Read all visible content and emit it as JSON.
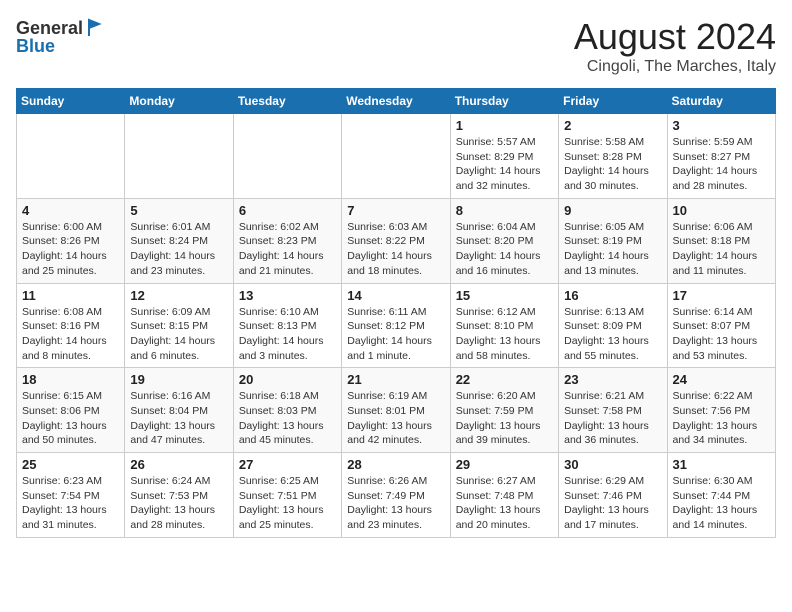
{
  "header": {
    "logo": {
      "line1": "General",
      "line2": "Blue"
    },
    "title": "August 2024",
    "location": "Cingoli, The Marches, Italy"
  },
  "calendar": {
    "weekdays": [
      "Sunday",
      "Monday",
      "Tuesday",
      "Wednesday",
      "Thursday",
      "Friday",
      "Saturday"
    ],
    "weeks": [
      [
        {
          "day": "",
          "info": ""
        },
        {
          "day": "",
          "info": ""
        },
        {
          "day": "",
          "info": ""
        },
        {
          "day": "",
          "info": ""
        },
        {
          "day": "1",
          "info": "Sunrise: 5:57 AM\nSunset: 8:29 PM\nDaylight: 14 hours\nand 32 minutes."
        },
        {
          "day": "2",
          "info": "Sunrise: 5:58 AM\nSunset: 8:28 PM\nDaylight: 14 hours\nand 30 minutes."
        },
        {
          "day": "3",
          "info": "Sunrise: 5:59 AM\nSunset: 8:27 PM\nDaylight: 14 hours\nand 28 minutes."
        }
      ],
      [
        {
          "day": "4",
          "info": "Sunrise: 6:00 AM\nSunset: 8:26 PM\nDaylight: 14 hours\nand 25 minutes."
        },
        {
          "day": "5",
          "info": "Sunrise: 6:01 AM\nSunset: 8:24 PM\nDaylight: 14 hours\nand 23 minutes."
        },
        {
          "day": "6",
          "info": "Sunrise: 6:02 AM\nSunset: 8:23 PM\nDaylight: 14 hours\nand 21 minutes."
        },
        {
          "day": "7",
          "info": "Sunrise: 6:03 AM\nSunset: 8:22 PM\nDaylight: 14 hours\nand 18 minutes."
        },
        {
          "day": "8",
          "info": "Sunrise: 6:04 AM\nSunset: 8:20 PM\nDaylight: 14 hours\nand 16 minutes."
        },
        {
          "day": "9",
          "info": "Sunrise: 6:05 AM\nSunset: 8:19 PM\nDaylight: 14 hours\nand 13 minutes."
        },
        {
          "day": "10",
          "info": "Sunrise: 6:06 AM\nSunset: 8:18 PM\nDaylight: 14 hours\nand 11 minutes."
        }
      ],
      [
        {
          "day": "11",
          "info": "Sunrise: 6:08 AM\nSunset: 8:16 PM\nDaylight: 14 hours\nand 8 minutes."
        },
        {
          "day": "12",
          "info": "Sunrise: 6:09 AM\nSunset: 8:15 PM\nDaylight: 14 hours\nand 6 minutes."
        },
        {
          "day": "13",
          "info": "Sunrise: 6:10 AM\nSunset: 8:13 PM\nDaylight: 14 hours\nand 3 minutes."
        },
        {
          "day": "14",
          "info": "Sunrise: 6:11 AM\nSunset: 8:12 PM\nDaylight: 14 hours\nand 1 minute."
        },
        {
          "day": "15",
          "info": "Sunrise: 6:12 AM\nSunset: 8:10 PM\nDaylight: 13 hours\nand 58 minutes."
        },
        {
          "day": "16",
          "info": "Sunrise: 6:13 AM\nSunset: 8:09 PM\nDaylight: 13 hours\nand 55 minutes."
        },
        {
          "day": "17",
          "info": "Sunrise: 6:14 AM\nSunset: 8:07 PM\nDaylight: 13 hours\nand 53 minutes."
        }
      ],
      [
        {
          "day": "18",
          "info": "Sunrise: 6:15 AM\nSunset: 8:06 PM\nDaylight: 13 hours\nand 50 minutes."
        },
        {
          "day": "19",
          "info": "Sunrise: 6:16 AM\nSunset: 8:04 PM\nDaylight: 13 hours\nand 47 minutes."
        },
        {
          "day": "20",
          "info": "Sunrise: 6:18 AM\nSunset: 8:03 PM\nDaylight: 13 hours\nand 45 minutes."
        },
        {
          "day": "21",
          "info": "Sunrise: 6:19 AM\nSunset: 8:01 PM\nDaylight: 13 hours\nand 42 minutes."
        },
        {
          "day": "22",
          "info": "Sunrise: 6:20 AM\nSunset: 7:59 PM\nDaylight: 13 hours\nand 39 minutes."
        },
        {
          "day": "23",
          "info": "Sunrise: 6:21 AM\nSunset: 7:58 PM\nDaylight: 13 hours\nand 36 minutes."
        },
        {
          "day": "24",
          "info": "Sunrise: 6:22 AM\nSunset: 7:56 PM\nDaylight: 13 hours\nand 34 minutes."
        }
      ],
      [
        {
          "day": "25",
          "info": "Sunrise: 6:23 AM\nSunset: 7:54 PM\nDaylight: 13 hours\nand 31 minutes."
        },
        {
          "day": "26",
          "info": "Sunrise: 6:24 AM\nSunset: 7:53 PM\nDaylight: 13 hours\nand 28 minutes."
        },
        {
          "day": "27",
          "info": "Sunrise: 6:25 AM\nSunset: 7:51 PM\nDaylight: 13 hours\nand 25 minutes."
        },
        {
          "day": "28",
          "info": "Sunrise: 6:26 AM\nSunset: 7:49 PM\nDaylight: 13 hours\nand 23 minutes."
        },
        {
          "day": "29",
          "info": "Sunrise: 6:27 AM\nSunset: 7:48 PM\nDaylight: 13 hours\nand 20 minutes."
        },
        {
          "day": "30",
          "info": "Sunrise: 6:29 AM\nSunset: 7:46 PM\nDaylight: 13 hours\nand 17 minutes."
        },
        {
          "day": "31",
          "info": "Sunrise: 6:30 AM\nSunset: 7:44 PM\nDaylight: 13 hours\nand 14 minutes."
        }
      ]
    ]
  }
}
